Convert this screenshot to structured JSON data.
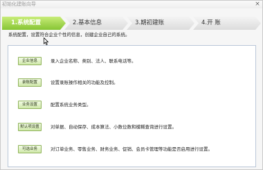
{
  "window": {
    "title": "初始化建账向导",
    "close_glyph": "×"
  },
  "steps": [
    {
      "label": "1.系统配置",
      "state": "active"
    },
    {
      "label": "2.基本信息",
      "state": "inactive"
    },
    {
      "label": "3.期初建账",
      "state": "inactive"
    },
    {
      "label": "4.开 账",
      "state": "inactive"
    }
  ],
  "description": "系统配置，设置符合企业个性的信息，创建企业自己的系统。",
  "rows": [
    {
      "button": "企业信息",
      "text": "录入企业名称、类别、法人、联系电话等。"
    },
    {
      "button": "录账配置",
      "text": "设置录账操作相关的功能及控制。"
    },
    {
      "button": "业务设置",
      "text": "配置系统业务类型。"
    },
    {
      "button": "默认项设置",
      "text": "对单据、自动保存、成本算法、小数位数和模糊查询进行设置。"
    },
    {
      "button": "可选业务",
      "text": "对订单业务、零售业务、财务业务、促销、会员卡管理等功能是否启用进行设置。"
    }
  ],
  "colors": {
    "accent": "#86c534",
    "panel_border": "#b9c7d8"
  },
  "icons": {
    "cursor": "mouse-pointer-icon",
    "close": "close-icon"
  }
}
